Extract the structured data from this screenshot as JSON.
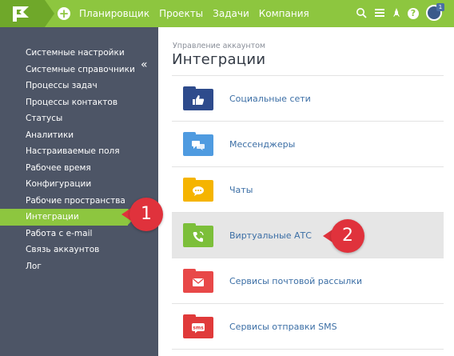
{
  "topbar": {
    "nav": [
      "Планировщик",
      "Проекты",
      "Задачи",
      "Компания"
    ],
    "avatar_badge": "1",
    "colors": {
      "bar": "#8dc63f",
      "logo": "#6fa82a"
    }
  },
  "sidebar": {
    "collapse_glyph": "«",
    "items": [
      {
        "label": "Системные настройки"
      },
      {
        "label": "Системные справочники"
      },
      {
        "label": "Процессы задач"
      },
      {
        "label": "Процессы контактов"
      },
      {
        "label": "Статусы"
      },
      {
        "label": "Аналитики"
      },
      {
        "label": "Настраиваемые поля"
      },
      {
        "label": "Рабочее время"
      },
      {
        "label": "Конфигурации"
      },
      {
        "label": "Рабочие пространства"
      },
      {
        "label": "Интеграции",
        "active": true
      },
      {
        "label": "Работа с e-mail"
      },
      {
        "label": "Связь аккаунтов"
      },
      {
        "label": "Лог"
      }
    ]
  },
  "main": {
    "breadcrumb": "Управление аккаунтом",
    "title": "Интеграции",
    "rows": [
      {
        "label": "Социальные сети",
        "icon": "thumbs-up-icon",
        "color": "#2e4b8c"
      },
      {
        "label": "Мессенджеры",
        "icon": "chat-bubbles-icon",
        "color": "#4f9be0"
      },
      {
        "label": "Чаты",
        "icon": "chat-dots-icon",
        "color": "#f5b400"
      },
      {
        "label": "Виртуальные АТС",
        "icon": "phone-icon",
        "color": "#7cbf3a",
        "highlight": true
      },
      {
        "label": "Сервисы почтовой рассылки",
        "icon": "envelope-icon",
        "color": "#e84848"
      },
      {
        "label": "Сервисы отправки SMS",
        "icon": "sms-icon",
        "color": "#e03a3a",
        "sms_text": "sms"
      }
    ]
  },
  "callouts": [
    "1",
    "2"
  ]
}
